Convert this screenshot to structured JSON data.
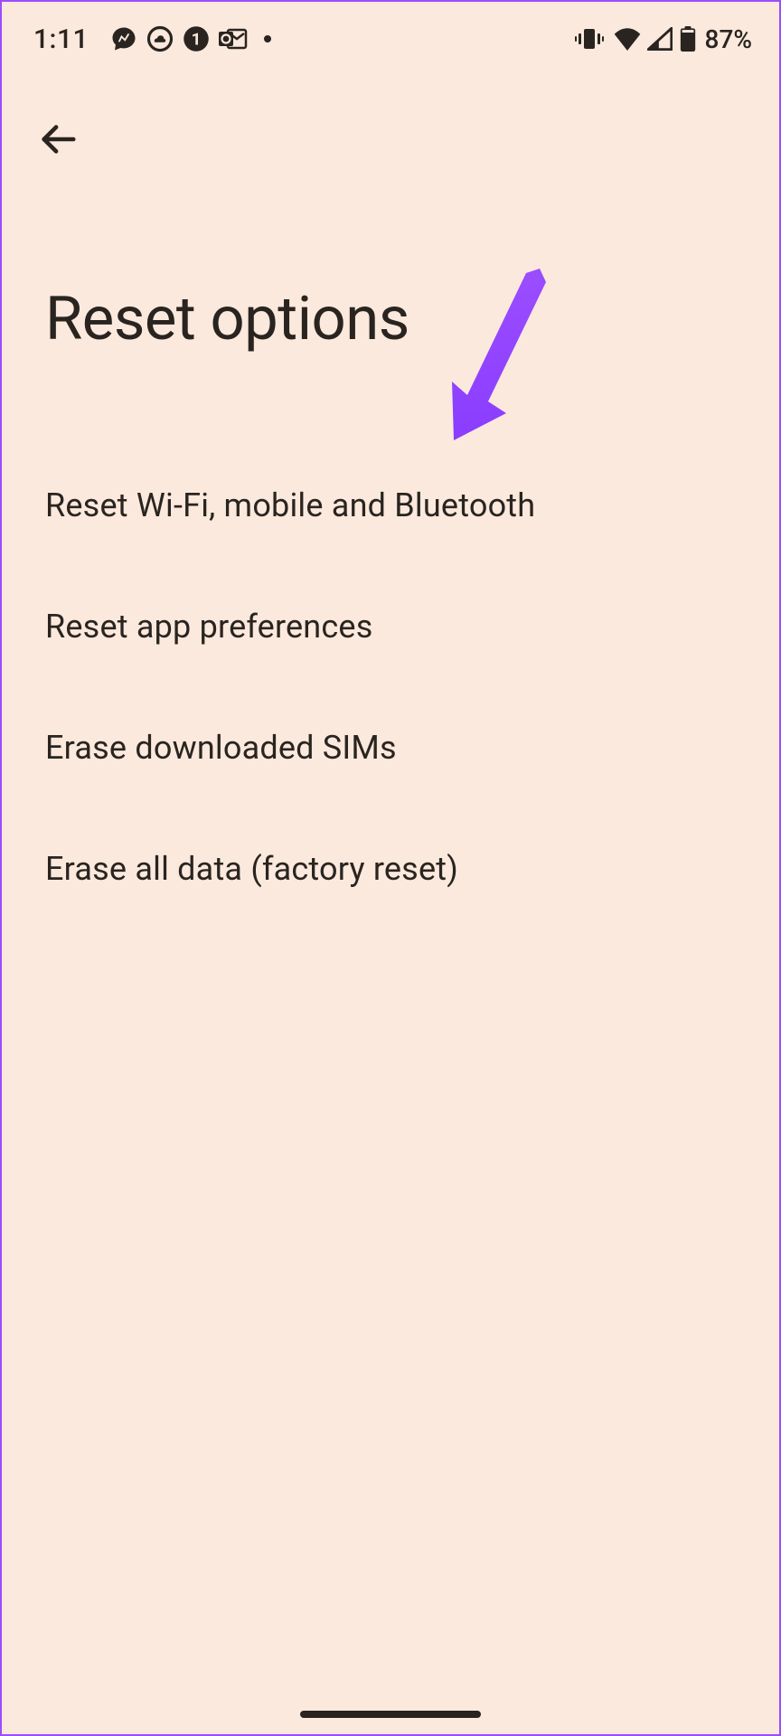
{
  "status_bar": {
    "time": "1:11",
    "battery_percent": "87%"
  },
  "header": {
    "title": "Reset options"
  },
  "options": [
    {
      "label": "Reset Wi-Fi, mobile and Bluetooth"
    },
    {
      "label": "Reset app preferences"
    },
    {
      "label": "Erase downloaded SIMs"
    },
    {
      "label": "Erase all data (factory reset)"
    }
  ]
}
